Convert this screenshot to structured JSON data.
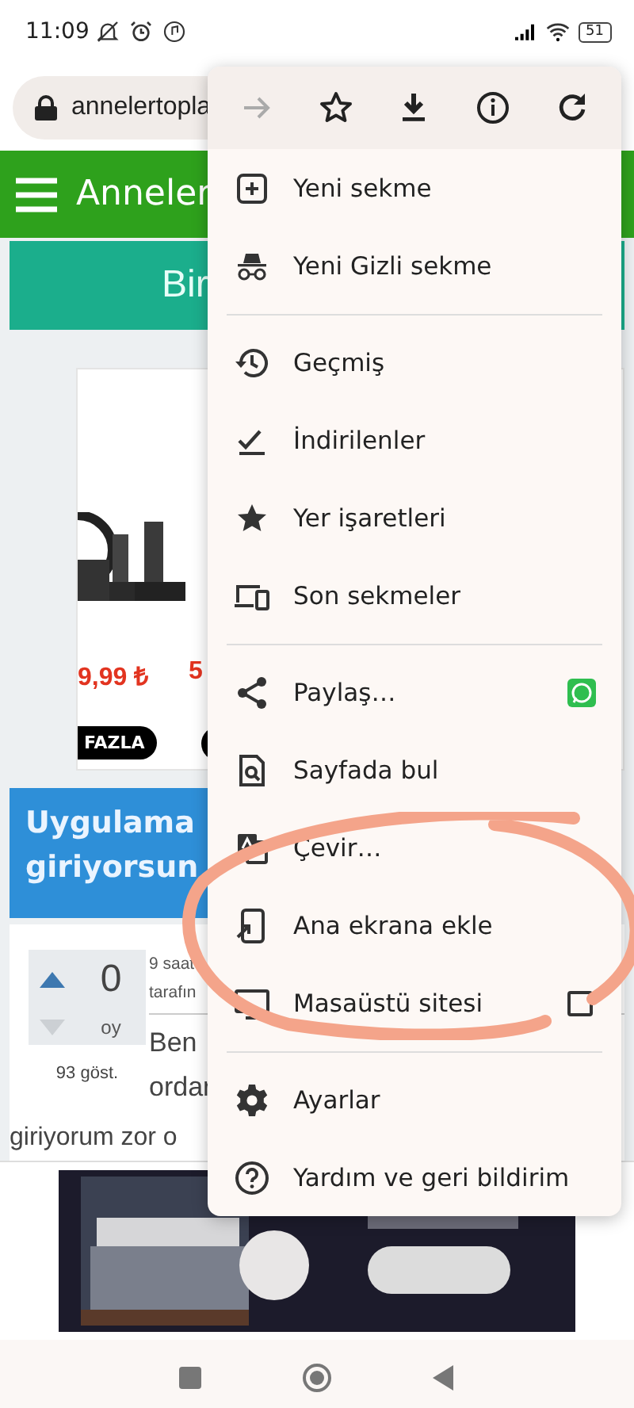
{
  "status_bar": {
    "time": "11:09",
    "battery": "51"
  },
  "address_bar": {
    "url": "annelertopla"
  },
  "site_header": {
    "title": "Anneler"
  },
  "banner": {
    "text": "Bir"
  },
  "product_card": {
    "prices": [
      "9,99 ₺",
      "5"
    ],
    "badge": "FAZLA"
  },
  "question": {
    "title": "Uygulama giriyorsun",
    "votes": "0",
    "votes_label": "oy",
    "views": "93 göst.",
    "meta": [
      "9 saat",
      "tarafın"
    ],
    "body": [
      "Ben",
      "ordar"
    ],
    "body_last": "giriyorum zor o"
  },
  "menu": {
    "toolbar": [
      {
        "disabled": true
      },
      {
        "disabled": false
      },
      {
        "disabled": false
      },
      {
        "disabled": false
      },
      {
        "disabled": false
      }
    ],
    "items": [
      {
        "kind": "item",
        "label": "Yeni sekme"
      },
      {
        "kind": "item",
        "label": "Yeni Gizli sekme"
      },
      {
        "kind": "divider"
      },
      {
        "kind": "item",
        "label": "Geçmiş"
      },
      {
        "kind": "item",
        "label": "İndirilenler"
      },
      {
        "kind": "item",
        "label": "Yer işaretleri"
      },
      {
        "kind": "item",
        "label": "Son sekmeler"
      },
      {
        "kind": "divider"
      },
      {
        "kind": "share",
        "label": "Paylaş…"
      },
      {
        "kind": "item",
        "label": "Sayfada bul"
      },
      {
        "kind": "item",
        "label": "Çevir…"
      },
      {
        "kind": "item",
        "label": "Ana ekrana ekle"
      },
      {
        "kind": "checkbox",
        "label": "Masaüstü sitesi",
        "checked": false
      },
      {
        "kind": "divider"
      },
      {
        "kind": "item",
        "label": "Ayarlar"
      },
      {
        "kind": "item",
        "label": "Yardım ve geri bildirim"
      }
    ]
  }
}
